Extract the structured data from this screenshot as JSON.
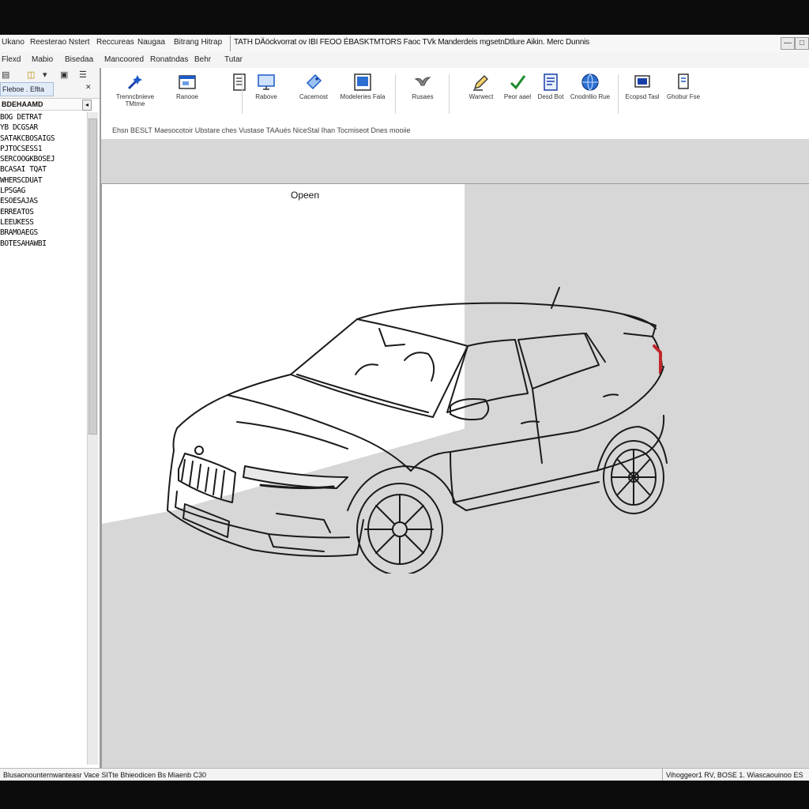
{
  "window": {
    "title": "TATH DÄöckvorrat ov IBI FEOO ÉBASKTMTORS Faoc TVk Manderdeis mgsetnDtlure Aikin. Merc Dunnis",
    "controls": [
      "—",
      "□",
      "✕"
    ]
  },
  "title_menus": [
    "Ukano",
    "Reesterao Nstert",
    "Reccureas",
    "Naugaa",
    "Bitrang Hitrap"
  ],
  "menubar": [
    "Flexd",
    "Mabio",
    "Bisedaa",
    "Mancoored",
    "Ronatndas",
    "Behr",
    "Tutar"
  ],
  "left_panel": {
    "tab_label": "Fleboe . Eflta",
    "header": "BDEHAAMD",
    "rows": [
      "BOG DETRAT",
      "YB DCGSAR",
      "SATAKCBOSAIGS",
      "PJTOCSESS1",
      "SERCOOGKBOSEJ",
      "BCASAI TQAT",
      "WHERSCDUAT",
      "LPSGAG",
      "ESOESAJAS",
      "ERREATOS",
      "LEEUKESS",
      "BRAMOAEGS",
      "BOTESAHAWBI"
    ]
  },
  "toolbar": {
    "tools": [
      {
        "label": "Trenncbnieve TMtme",
        "icon": "wand-icon"
      },
      {
        "label": "Ranooe",
        "icon": "window-icon"
      },
      {
        "label": "Rabove",
        "icon": "monitor-icon"
      },
      {
        "label": "Cacemost",
        "icon": "tag-icon"
      },
      {
        "label": "Modeleries Fala",
        "icon": "framed-picture-icon"
      },
      {
        "label": "Rusaes",
        "icon": "bird-icon"
      },
      {
        "label": "Warwect",
        "icon": "pencil-icon"
      },
      {
        "label": "Peor aael",
        "icon": "check-icon"
      },
      {
        "label": "Desd Bot",
        "icon": "document-icon"
      },
      {
        "label": "Cnodnllio Rue",
        "icon": "globe-icon"
      },
      {
        "label": "Ecopsd Tasl",
        "icon": "screen-icon"
      },
      {
        "label": "Ghobur Fse",
        "icon": "file-icon"
      }
    ],
    "group_label": "Ehsn BESLT Maesocotoir Ubstare ches Vustase   TAAués NiceStal Ihan Tocmiseot Dnes mooiie"
  },
  "canvas": {
    "open_label": "Opeen"
  },
  "status": {
    "left": "Blusaonounternwanteasr Vace SITte Bhieodicen Bs Miaenb C30",
    "right": "Vihoggeor1 RV, BOSE 1. Wiascaouinoo ES"
  },
  "colors": {
    "accent_blue": "#1a5bc8",
    "green": "#1b8a2a",
    "workspace": "#d7d7d7"
  }
}
